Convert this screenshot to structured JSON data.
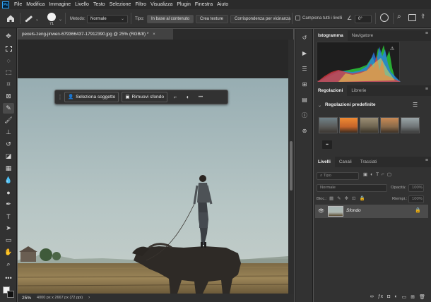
{
  "menu": {
    "app_icon": "Ps",
    "items": [
      "File",
      "Modifica",
      "Immagine",
      "Livello",
      "Testo",
      "Selezione",
      "Filtro",
      "Visualizza",
      "Plugin",
      "Finestra",
      "Aiuto"
    ]
  },
  "options": {
    "brush_size": "71",
    "metodo_label": "Metodo:",
    "metodo_value": "Normale",
    "tipo_label": "Tipo:",
    "tipo_buttons": [
      "In base al contenuto",
      "Crea texture",
      "Corrispondenza per vicinanza"
    ],
    "sample_all_label": "Campiona tutti i livelli",
    "angle_value": "0°"
  },
  "document": {
    "tab_title": "pexels-zeng-jinwen-679366437-17912390.jpg @ 25% (RGB/8) *",
    "close_glyph": "×"
  },
  "contextual_bar": {
    "select_subject": "Seleziona soggetto",
    "remove_background": "Rimuovi sfondo",
    "more": "•••"
  },
  "status": {
    "zoom": "25%",
    "info": "4000 px x 2667 px (72 ppi)"
  },
  "panels": {
    "top_tabs": [
      "Istogramma",
      "Navigatore"
    ],
    "mid_tabs": [
      "Regolazioni",
      "Librerie"
    ],
    "presets_title": "Regolazioni predefinite",
    "layers_tabs": [
      "Livelli",
      "Canali",
      "Tracciati"
    ],
    "search_placeholder": "Tipo",
    "blend_mode": "Normale",
    "opacity_label": "Opacità:",
    "opacity_value": "100%",
    "lock_label": "Bloc.:",
    "fill_label": "Riempi.:",
    "fill_value": "100%",
    "layer_name": "Sfondo"
  },
  "colors": {
    "accent": "#31a8ff",
    "menu_bg": "#2b2b2b",
    "panel_bg": "#323232"
  }
}
